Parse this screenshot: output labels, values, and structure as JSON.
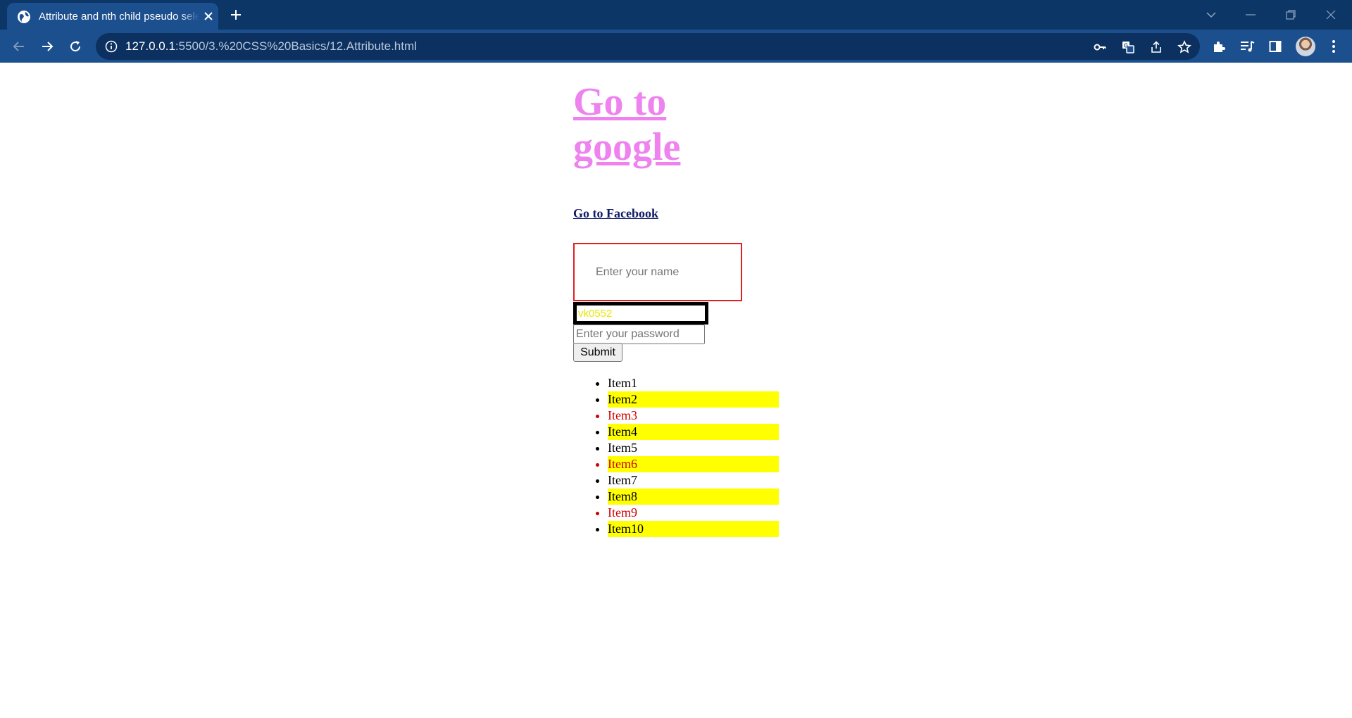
{
  "browser": {
    "tab_title": "Attribute and nth child pseudo selectors",
    "url_host": "127.0.0.1",
    "url_path": ":5500/3.%20CSS%20Basics/12.Attribute.html"
  },
  "page": {
    "google_link": "Go to google",
    "facebook_link": "Go to Facebook",
    "name_placeholder": "Enter your name",
    "email_value": "vk0552",
    "password_placeholder": "Enter your password",
    "submit_label": "Submit",
    "items": [
      "Item1",
      "Item2",
      "Item3",
      "Item4",
      "Item5",
      "Item6",
      "Item7",
      "Item8",
      "Item9",
      "Item10"
    ]
  },
  "colors": {
    "tab_strip": "#0b3666",
    "toolbar": "#1b4f8e",
    "google_link": "#ee82ee",
    "name_border": "#e02020",
    "email_text": "#e8e800",
    "even_item_bg": "#ffff00",
    "third_item_text": "#d00000"
  }
}
